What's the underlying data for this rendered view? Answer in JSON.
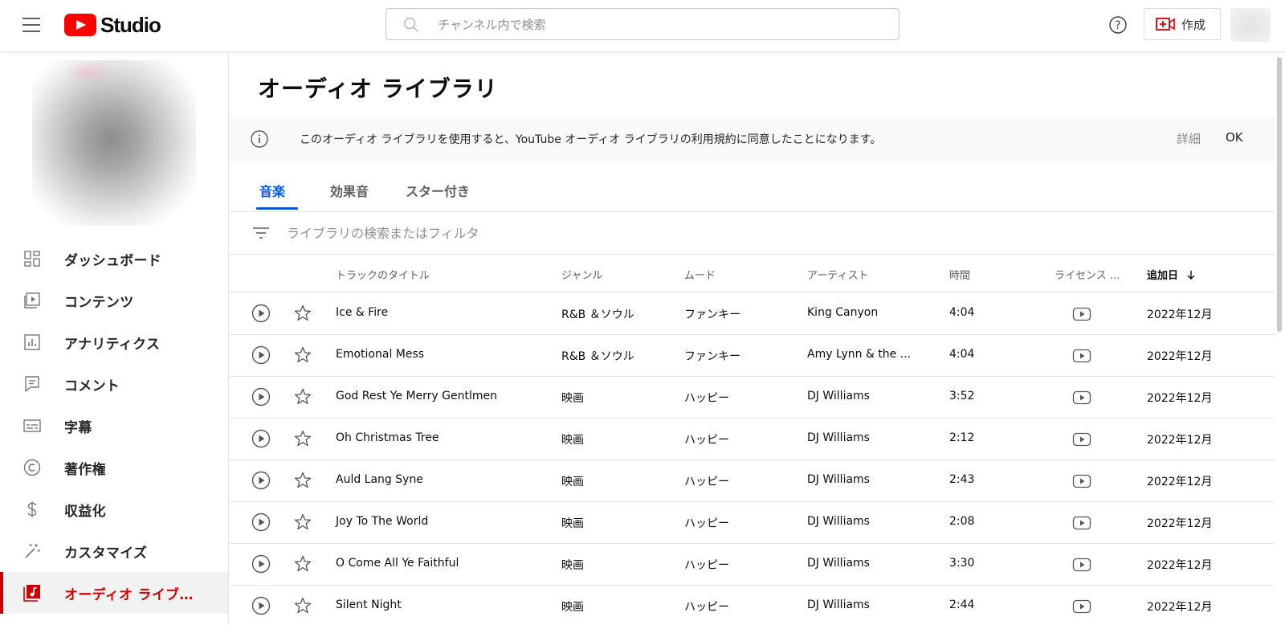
{
  "header": {
    "logo_text": "Studio",
    "search_placeholder": "チャンネル内で検索",
    "create_label": "作成",
    "icons": [
      "menu-icon",
      "youtube-logo-icon",
      "search-icon",
      "help-icon",
      "video-camera-plus-icon"
    ]
  },
  "sidebar": {
    "items": [
      {
        "label": "ダッシュボード",
        "icon": "dashboard-icon"
      },
      {
        "label": "コンテンツ",
        "icon": "content-icon"
      },
      {
        "label": "アナリティクス",
        "icon": "analytics-icon"
      },
      {
        "label": "コメント",
        "icon": "comment-icon"
      },
      {
        "label": "字幕",
        "icon": "subtitles-icon"
      },
      {
        "label": "著作権",
        "icon": "copyright-icon"
      },
      {
        "label": "収益化",
        "icon": "dollar-icon"
      },
      {
        "label": "カスタマイズ",
        "icon": "magic-wand-icon"
      },
      {
        "label": "オーディオ ライブ…",
        "icon": "audio-library-icon",
        "active": true
      }
    ]
  },
  "main": {
    "title": "オーディオ ライブラリ",
    "banner": {
      "message": "このオーディオ ライブラリを使用すると、YouTube オーディオ ライブラリの利用規約に同意したことになります。",
      "more_label": "詳細",
      "ok_label": "OK"
    },
    "tabs": [
      {
        "label": "音楽",
        "active": true
      },
      {
        "label": "効果音",
        "active": false
      },
      {
        "label": "スター付き",
        "active": false
      }
    ],
    "filter_placeholder": "ライブラリの検索またはフィルタ",
    "table": {
      "headers": {
        "title": "トラックのタイトル",
        "genre": "ジャンル",
        "mood": "ムード",
        "artist": "アーティスト",
        "duration": "時間",
        "license": "ライセンス ...",
        "added": "追加日"
      },
      "sort": {
        "column": "added",
        "direction": "descending"
      },
      "rows": [
        {
          "title": "Ice & Fire",
          "genre": "R&B ＆ソウル",
          "mood": "ファンキー",
          "artist": "King Canyon",
          "duration": "4:04",
          "added": "2022年12月"
        },
        {
          "title": "Emotional Mess",
          "genre": "R&B ＆ソウル",
          "mood": "ファンキー",
          "artist": "Amy Lynn & the ...",
          "duration": "4:04",
          "added": "2022年12月"
        },
        {
          "title": "God Rest Ye Merry Gentlmen",
          "genre": "映画",
          "mood": "ハッピー",
          "artist": "DJ Williams",
          "duration": "3:52",
          "added": "2022年12月"
        },
        {
          "title": "Oh Christmas Tree",
          "genre": "映画",
          "mood": "ハッピー",
          "artist": "DJ Williams",
          "duration": "2:12",
          "added": "2022年12月"
        },
        {
          "title": "Auld Lang Syne",
          "genre": "映画",
          "mood": "ハッピー",
          "artist": "DJ Williams",
          "duration": "2:43",
          "added": "2022年12月"
        },
        {
          "title": "Joy To The World",
          "genre": "映画",
          "mood": "ハッピー",
          "artist": "DJ Williams",
          "duration": "2:08",
          "added": "2022年12月"
        },
        {
          "title": "O Come All Ye Faithful",
          "genre": "映画",
          "mood": "ハッピー",
          "artist": "DJ Williams",
          "duration": "3:30",
          "added": "2022年12月"
        },
        {
          "title": "Silent Night",
          "genre": "映画",
          "mood": "ハッピー",
          "artist": "DJ Williams",
          "duration": "2:44",
          "added": "2022年12月"
        }
      ]
    }
  },
  "colors": {
    "brand_red": "#ff0000",
    "active_red": "#cc0000",
    "tab_blue": "#0b57d0"
  }
}
